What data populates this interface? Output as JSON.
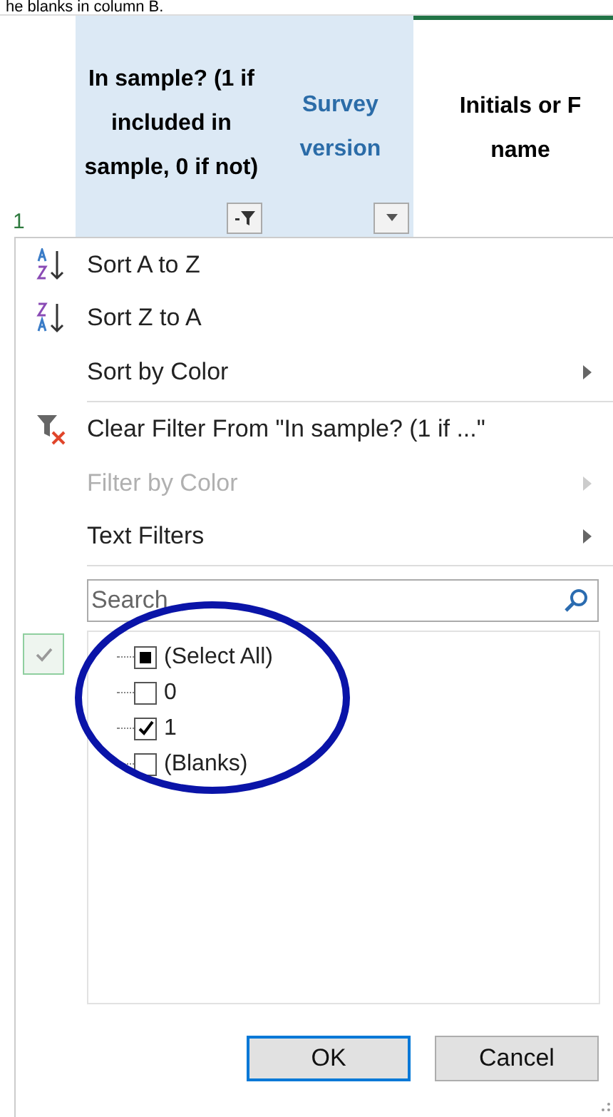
{
  "caption": "he blanks in column B.",
  "sheet": {
    "row_number": "1",
    "columns": [
      {
        "kind": "filtered",
        "header": "In sample? (1 if included in sample, 0 if not)",
        "selected": true
      },
      {
        "kind": "unfiltered",
        "header": "Survey version",
        "selected": true
      },
      {
        "kind": "plain",
        "header": "Initials or F name",
        "selected": false
      }
    ]
  },
  "menu": {
    "items": [
      {
        "kind": "sort-ascending",
        "label": "Sort A to Z",
        "disabled": false,
        "submenu": false
      },
      {
        "kind": "sort-descending",
        "label": "Sort Z to A",
        "disabled": false,
        "submenu": false
      },
      {
        "kind": "plain",
        "label": "Sort by Color",
        "disabled": false,
        "submenu": true
      },
      {
        "kind": "separator"
      },
      {
        "kind": "clear-filter",
        "label": "Clear Filter From \"In sample? (1 if ...\"",
        "disabled": false,
        "submenu": false
      },
      {
        "kind": "plain",
        "label": "Filter by Color",
        "disabled": true,
        "submenu": true
      },
      {
        "kind": "plain",
        "label": "Text Filters",
        "disabled": false,
        "submenu": true
      },
      {
        "kind": "separator"
      }
    ],
    "search": {
      "placeholder": "Search"
    },
    "values": [
      {
        "label": "(Select All)",
        "checked": false,
        "partial": true
      },
      {
        "label": "0",
        "checked": false
      },
      {
        "label": "1",
        "checked": true
      },
      {
        "label": "(Blanks)",
        "checked": false
      }
    ],
    "buttons": [
      {
        "label": "OK",
        "selected": true
      },
      {
        "label": "Cancel",
        "selected": false
      }
    ]
  }
}
